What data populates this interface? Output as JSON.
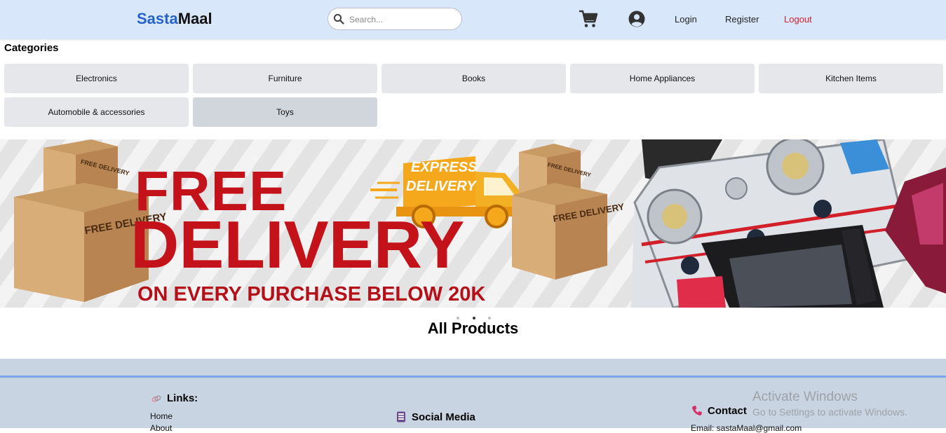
{
  "navbar": {
    "brand_part1": "Sasta",
    "brand_part2": "Maal",
    "search_placeholder": "Search...",
    "cart_icon": "shopping-cart-icon",
    "user_icon": "user-circle-icon",
    "login": "Login",
    "register": "Register",
    "logout": "Logout"
  },
  "categories": {
    "title": "Categories",
    "items": [
      "Electronics",
      "Furniture",
      "Books",
      "Home Appliances",
      "Kitchen Items",
      "Automobile & accessories",
      "Toys"
    ]
  },
  "banner": {
    "line1": "FREE",
    "line2": "DELIVERY",
    "line3": "ON EVERY PURCHASE BELOW 20K",
    "express1": "EXPRESS",
    "express2": "DELIVERY",
    "box_label": "FREE DELIVERY",
    "carousel_dots": 3,
    "active_dot": 2
  },
  "main": {
    "products_title": "All Products"
  },
  "footer": {
    "links_heading": "Links:",
    "links": [
      "Home",
      "About"
    ],
    "social_heading": "Social Media",
    "contact_heading": "Contact",
    "email": "Email: sastaMaal@gmail.com"
  },
  "os_overlay": {
    "line1": "Activate Windows",
    "line2": "Go to Settings to activate Windows."
  },
  "colors": {
    "navbar_bg": "#d9e7fb",
    "brand_accent": "#2563c9",
    "logout": "#d6202a",
    "banner_red": "#c4121b",
    "footer_bg": "#c9d4e2"
  }
}
